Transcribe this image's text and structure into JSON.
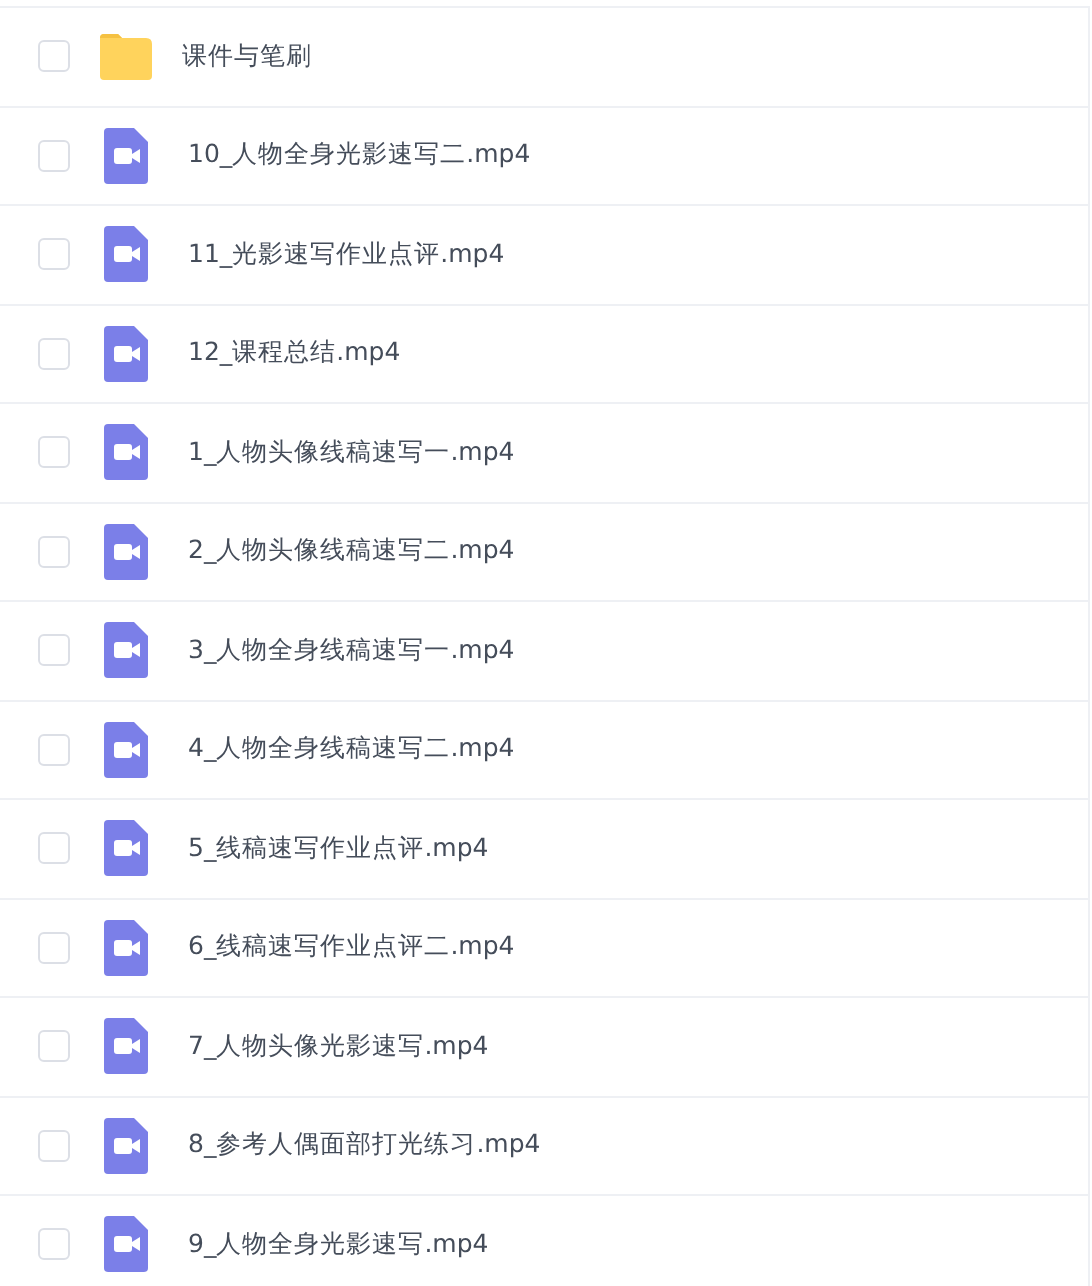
{
  "files": [
    {
      "kind": "folder",
      "name": "课件与笔刷",
      "checked": false
    },
    {
      "kind": "video",
      "name": "10_人物全身光影速写二.mp4",
      "checked": false
    },
    {
      "kind": "video",
      "name": "11_光影速写作业点评.mp4",
      "checked": false
    },
    {
      "kind": "video",
      "name": "12_课程总结.mp4",
      "checked": false
    },
    {
      "kind": "video",
      "name": "1_人物头像线稿速写一.mp4",
      "checked": false
    },
    {
      "kind": "video",
      "name": "2_人物头像线稿速写二.mp4",
      "checked": false
    },
    {
      "kind": "video",
      "name": "3_人物全身线稿速写一.mp4",
      "checked": false
    },
    {
      "kind": "video",
      "name": "4_人物全身线稿速写二.mp4",
      "checked": false
    },
    {
      "kind": "video",
      "name": "5_线稿速写作业点评.mp4",
      "checked": false
    },
    {
      "kind": "video",
      "name": "6_线稿速写作业点评二.mp4",
      "checked": false
    },
    {
      "kind": "video",
      "name": "7_人物头像光影速写.mp4",
      "checked": false
    },
    {
      "kind": "video",
      "name": "8_参考人偶面部打光练习.mp4",
      "checked": false
    },
    {
      "kind": "video",
      "name": "9_人物全身光影速写.mp4",
      "checked": false
    }
  ]
}
